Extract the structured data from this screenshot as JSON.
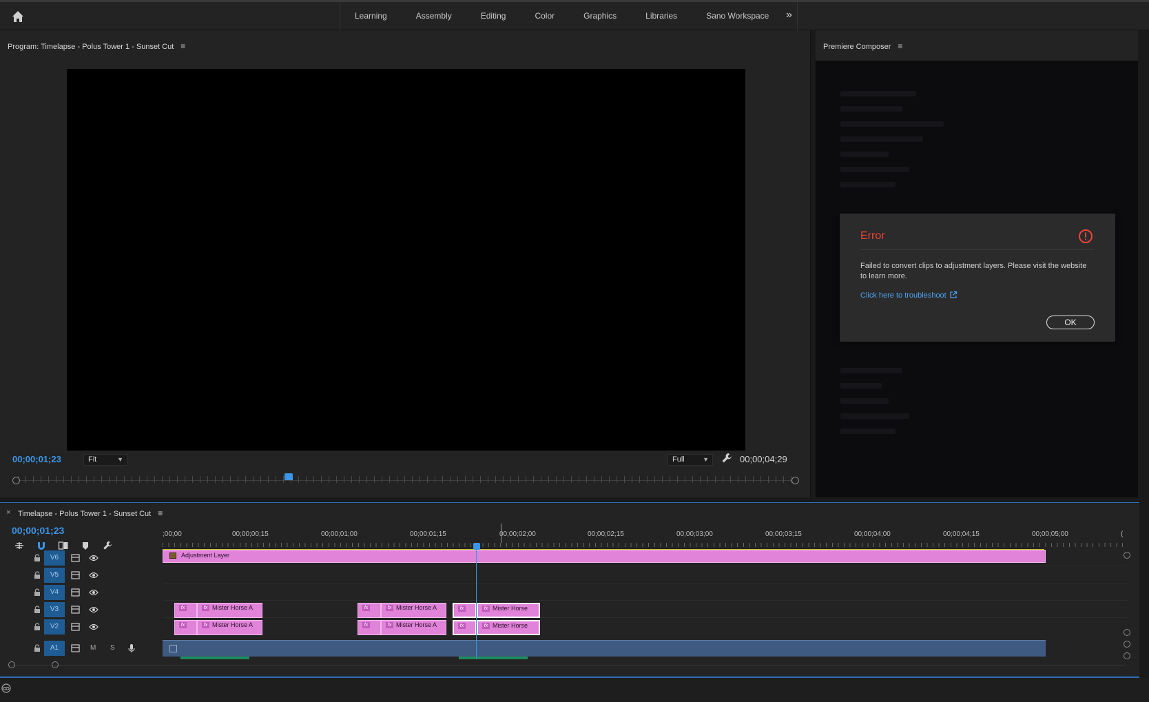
{
  "workspaces": [
    "Learning",
    "Assembly",
    "Editing",
    "Color",
    "Graphics",
    "Libraries",
    "Sano Workspace"
  ],
  "more_glyph": "»",
  "program": {
    "title": "Program: Timelapse - Polus Tower 1 - Sunset Cut",
    "menu_glyph": "≡",
    "current_tc": "00;00;01;23",
    "zoom": "Fit",
    "quality": "Full",
    "duration_tc": "00;00;04;29"
  },
  "composer": {
    "title": "Premiere Composer",
    "menu_glyph": "≡"
  },
  "error_dialog": {
    "title": "Error",
    "message": "Failed to convert clips to adjustment layers. Please visit the website to learn more.",
    "link": "Click here to troubleshoot",
    "ok": "OK",
    "accent": "#f0433a"
  },
  "timeline": {
    "close_glyph": "×",
    "title": "Timelapse - Polus Tower 1 - Sunset Cut",
    "menu_glyph": "≡",
    "current_tc": "00;00;01;23",
    "ruler": [
      ";00;00",
      "00;00;00;15",
      "00;00;01;00",
      "00;00;01;15",
      "00;00;02;00",
      "00;00;02;15",
      "00;00;03;00",
      "00;00;03;15",
      "00;00;04;00",
      "00;00;04;15",
      "00;00;05;00",
      "("
    ],
    "tracks": {
      "v6": "V6",
      "v5": "V5",
      "v4": "V4",
      "v3": "V3",
      "v2": "V2",
      "a1": "A1"
    },
    "adjustment_layer": "Adjustment Layer",
    "fx_label": "fx",
    "clip_name_a": "Mister Horse A",
    "clip_name_b": "Mister Horse",
    "mute": "M",
    "solo": "S"
  },
  "colors": {
    "accent_blue": "#3b95e8",
    "clip_pink": "#e083d9",
    "track_blue": "#1f5c94",
    "audio_blue": "#3f5a80"
  }
}
